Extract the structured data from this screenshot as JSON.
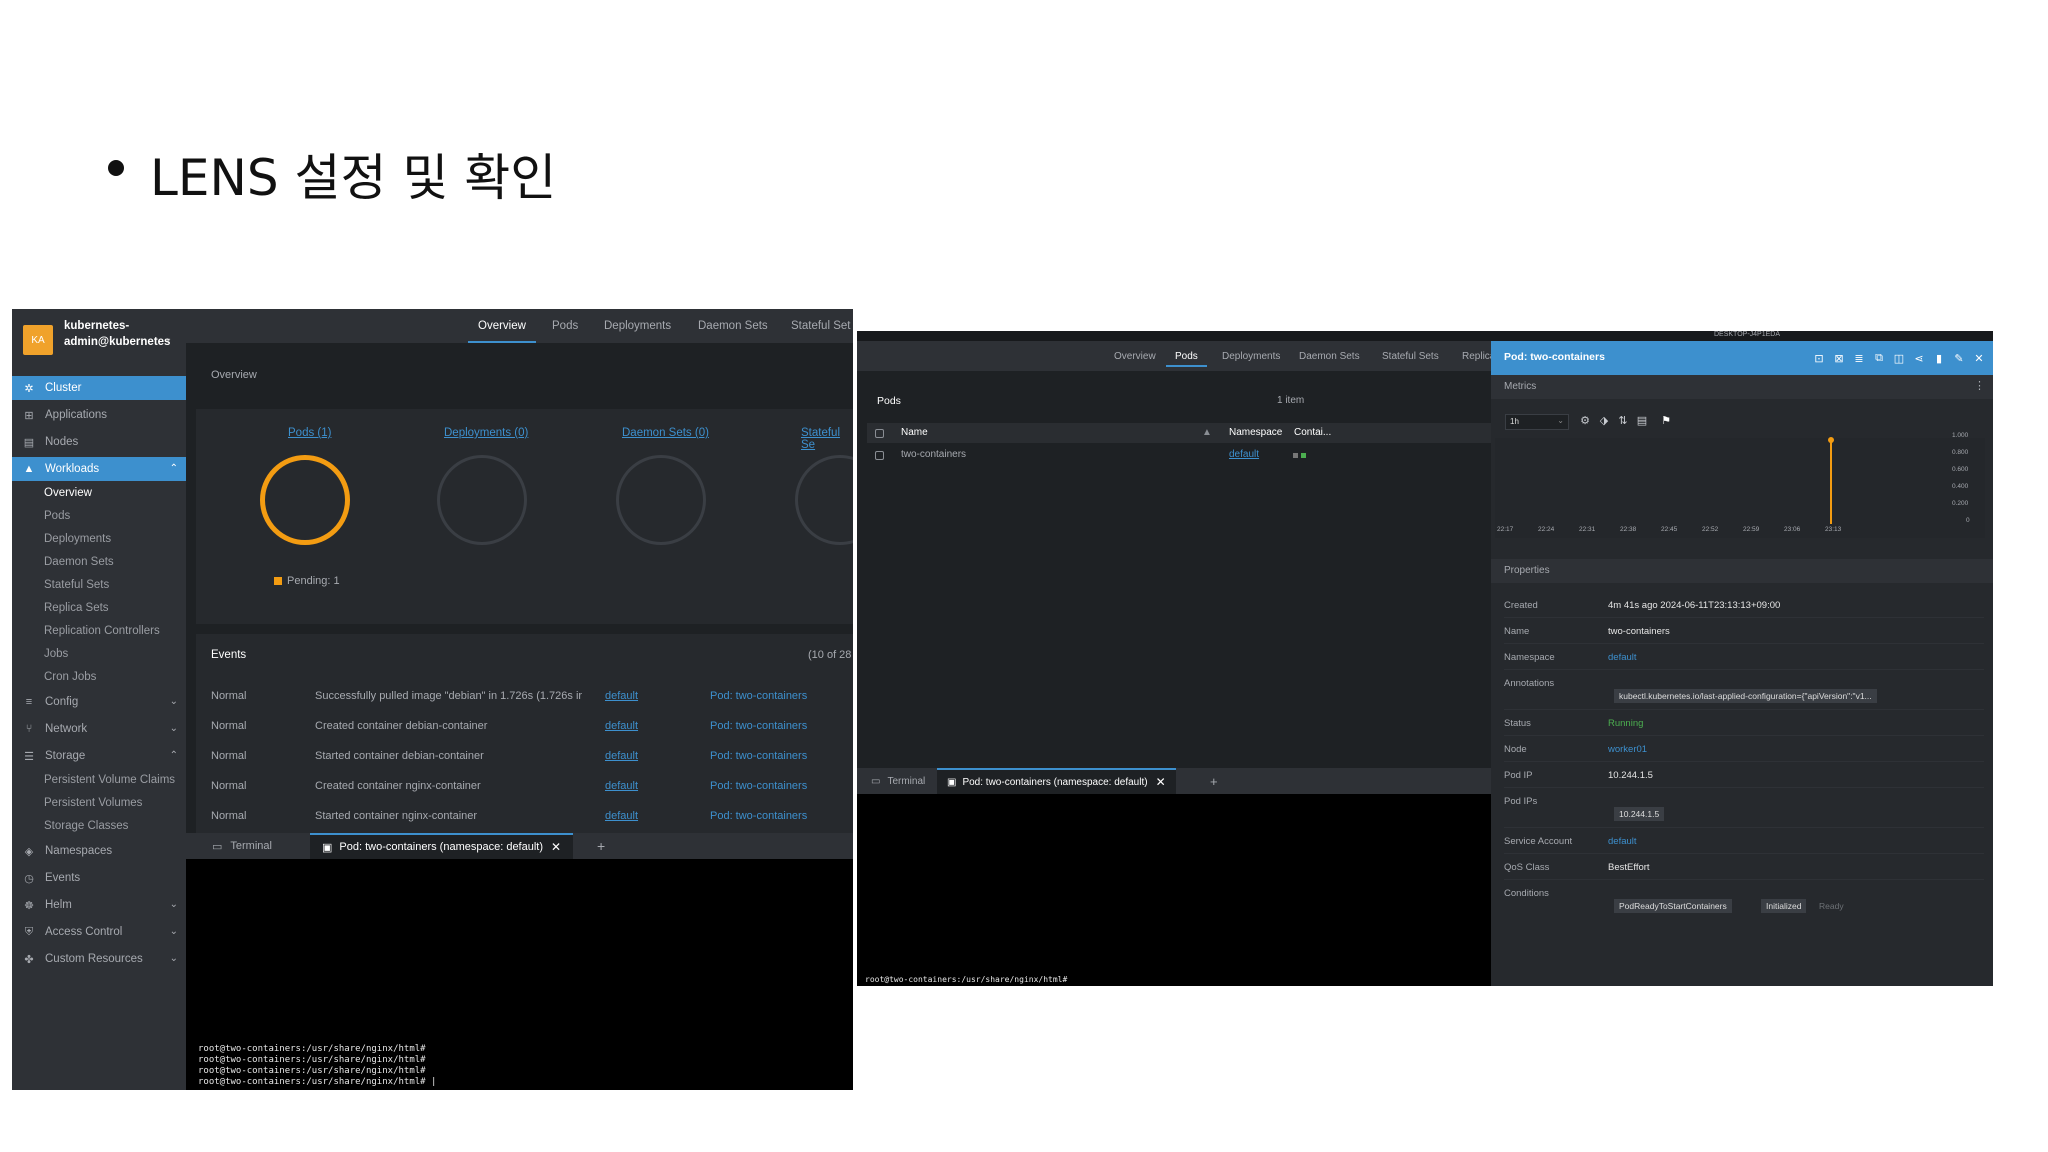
{
  "slide": {
    "title": "LENS 설정 및 확인"
  },
  "left": {
    "cluster": {
      "badge": "KA",
      "name": "kubernetes-admin@kubernetes"
    },
    "sidebar": {
      "cluster": "Cluster",
      "applications": "Applications",
      "nodes": "Nodes",
      "workloads": "Workloads",
      "workloads_items": [
        "Overview",
        "Pods",
        "Deployments",
        "Daemon Sets",
        "Stateful Sets",
        "Replica Sets",
        "Replication Controllers",
        "Jobs",
        "Cron Jobs"
      ],
      "config": "Config",
      "network": "Network",
      "storage": "Storage",
      "storage_items": [
        "Persistent Volume Claims",
        "Persistent Volumes",
        "Storage Classes"
      ],
      "namespaces": "Namespaces",
      "events": "Events",
      "helm": "Helm",
      "access_control": "Access Control",
      "custom_resources": "Custom Resources"
    },
    "tabs": [
      "Overview",
      "Pods",
      "Deployments",
      "Daemon Sets",
      "Stateful Set"
    ],
    "overview_label": "Overview",
    "cards": [
      {
        "label": "Pods (1)"
      },
      {
        "label": "Deployments (0)"
      },
      {
        "label": "Daemon Sets (0)"
      },
      {
        "label": "Stateful Se"
      }
    ],
    "pending": "Pending: 1",
    "events": {
      "title": "Events",
      "count": "(10 of 28",
      "rows": [
        {
          "type": "Normal",
          "message": "Successfully pulled image \"debian\" in 1.726s (1.726s ir",
          "namespace": "default",
          "object": "Pod: two-containers"
        },
        {
          "type": "Normal",
          "message": "Created container debian-container",
          "namespace": "default",
          "object": "Pod: two-containers"
        },
        {
          "type": "Normal",
          "message": "Started container debian-container",
          "namespace": "default",
          "object": "Pod: two-containers"
        },
        {
          "type": "Normal",
          "message": "Created container nginx-container",
          "namespace": "default",
          "object": "Pod: two-containers"
        },
        {
          "type": "Normal",
          "message": "Started container nginx-container",
          "namespace": "default",
          "object": "Pod: two-containers"
        }
      ]
    },
    "terminal": {
      "tab": "Terminal",
      "pod_tab": "Pod: two-containers (namespace: default)",
      "plus": "+",
      "lines": "root@two-containers:/usr/share/nginx/html#\nroot@two-containers:/usr/share/nginx/html#\nroot@two-containers:/usr/share/nginx/html#\nroot@two-containers:/usr/share/nginx/html# |"
    }
  },
  "right": {
    "topbar": "DESKTOP-J4P1EDA",
    "tabs": [
      "Overview",
      "Pods",
      "Deployments",
      "Daemon Sets",
      "Stateful Sets",
      "Replica"
    ],
    "pods_title": "Pods",
    "pods_count": "1 item",
    "columns": {
      "name": "Name",
      "namespace": "Namespace",
      "containers": "Contai..."
    },
    "row": {
      "name": "two-containers",
      "namespace": "default"
    },
    "terminal": {
      "tab": "Terminal",
      "pod_tab": "Pod: two-containers (namespace: default)",
      "plus": "+",
      "line": "root@two-containers:/usr/share/nginx/html#"
    },
    "detail": {
      "title": "Pod: two-containers",
      "metrics": "Metrics",
      "range": "1h",
      "y_ticks": [
        "1.000",
        "0.800",
        "0.600",
        "0.400",
        "0.200",
        "0"
      ],
      "x_ticks": [
        "22:17",
        "22:24",
        "22:31",
        "22:38",
        "22:45",
        "22:52",
        "22:59",
        "23:06",
        "23:13"
      ],
      "properties": "Properties",
      "props": {
        "created_k": "Created",
        "created_v": "4m 41s ago 2024-06-11T23:13:13+09:00",
        "name_k": "Name",
        "name_v": "two-containers",
        "namespace_k": "Namespace",
        "namespace_v": "default",
        "annotations_k": "Annotations",
        "annotations_v": "kubectl.kubernetes.io/last-applied-configuration={\"apiVersion\":\"v1...",
        "status_k": "Status",
        "status_v": "Running",
        "node_k": "Node",
        "node_v": "worker01",
        "podip_k": "Pod IP",
        "podip_v": "10.244.1.5",
        "podips_k": "Pod IPs",
        "podips_v": "10.244.1.5",
        "sa_k": "Service Account",
        "sa_v": "default",
        "qos_k": "QoS Class",
        "qos_v": "BestEffort",
        "cond_k": "Conditions",
        "conditions": [
          "PodReadyToStartContainers",
          "Initialized",
          "Ready"
        ]
      }
    }
  },
  "colors": {
    "accent": "#3d90ce",
    "warning": "#f39c12",
    "success": "#4caf50",
    "panel": "#1e2124"
  }
}
